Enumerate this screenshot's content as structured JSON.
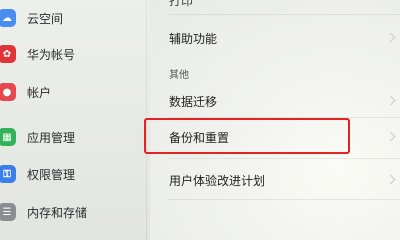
{
  "sidebar": {
    "items": [
      {
        "label": "云空间",
        "icon": "cloud-icon",
        "color": "#4b8cf0"
      },
      {
        "label": "华为帐号",
        "icon": "huawei-icon",
        "color": "#e0333a"
      },
      {
        "label": "帐户",
        "icon": "account-icon",
        "color": "#e5484d"
      },
      {
        "label": "应用管理",
        "icon": "apps-icon",
        "color": "#34b25a"
      },
      {
        "label": "权限管理",
        "icon": "permission-icon",
        "color": "#3c7ee8"
      },
      {
        "label": "内存和存储",
        "icon": "storage-icon",
        "color": "#8a8d92"
      }
    ]
  },
  "main": {
    "top_partial": "打印",
    "accessibility": "辅助功能",
    "section_other": "其他",
    "data_migration": "数据迁移",
    "backup_reset": "备份和重置",
    "user_experience": "用户体验改进计划"
  },
  "colors": {
    "highlight": "#e32222"
  }
}
